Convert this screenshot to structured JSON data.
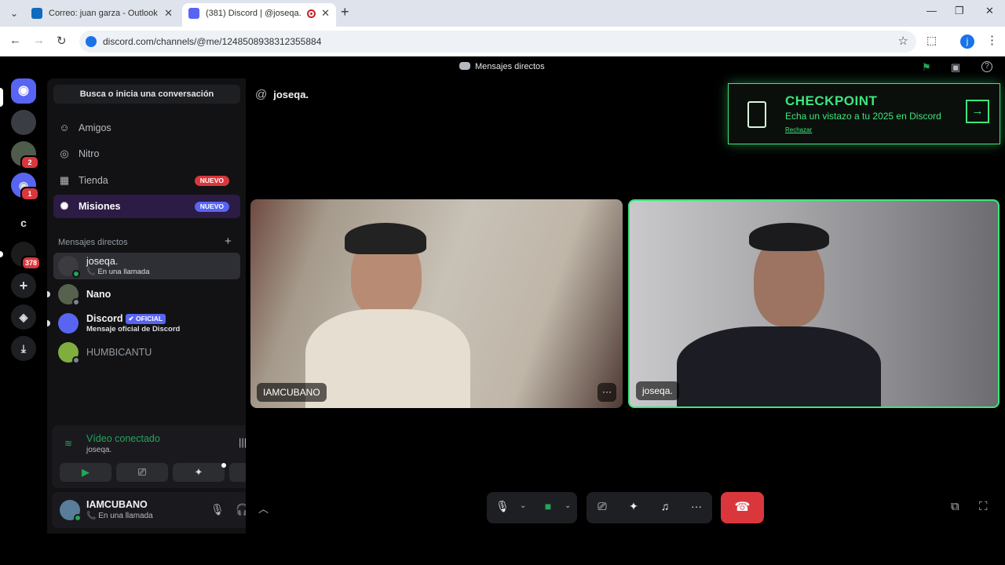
{
  "browser": {
    "tab_menu": "⌄",
    "tabs": [
      {
        "title": "Correo: juan garza - Outlook",
        "close": "✕"
      },
      {
        "title": "(381) Discord | @joseqa.",
        "close": "✕"
      }
    ],
    "new_tab": "+",
    "window_controls": {
      "minimize": "—",
      "maximize": "❐",
      "close": "✕"
    },
    "back": "←",
    "forward": "→",
    "reload": "↻",
    "url": "discord.com/channels/@me/1248508938312355884",
    "bookmark_star": "☆",
    "extensions": "⬚",
    "profile_initial": "j",
    "menu": "⋮"
  },
  "discord_top": {
    "title": "Mensajes directos",
    "icons": {
      "flag": "⚑",
      "inbox": "▣",
      "help": "?"
    }
  },
  "rail": {
    "home_glyph": "◉",
    "servers": [
      {
        "label": "",
        "badge": ""
      },
      {
        "label": "",
        "badge": "2"
      },
      {
        "label": "◉",
        "badge": "1"
      },
      {
        "label": "c",
        "badge": ""
      },
      {
        "label": "",
        "badge": "378"
      }
    ],
    "add": "+",
    "discover": "◈",
    "download": "⤓"
  },
  "sidebar": {
    "search_placeholder": "Busca o inicia una conversación",
    "nav": [
      {
        "label": "Amigos",
        "icon": "☺",
        "badge": ""
      },
      {
        "label": "Nitro",
        "icon": "◎",
        "badge": ""
      },
      {
        "label": "Tienda",
        "icon": "▦",
        "badge": "NUEVO"
      },
      {
        "label": "Misiones",
        "icon": "✺",
        "badge": "NUEVO"
      }
    ],
    "dm_header": "Mensajes directos",
    "dm_add": "+",
    "dms": [
      {
        "name": "joseqa.",
        "sub": "📞 En una llamada"
      },
      {
        "name": "Nano",
        "sub": ""
      },
      {
        "name": "Discord",
        "badge": "✔ OFICIAL",
        "sub": "Mensaje oficial de Discord"
      },
      {
        "name": "HUMBICANTU",
        "sub": ""
      }
    ]
  },
  "voice": {
    "title": "Vídeo conectado",
    "subtitle": "joseqa.",
    "signal_icon": "≋",
    "noise_icon": "|||",
    "disconnect_icon": "☎",
    "buttons": {
      "camera": "▶",
      "screen": "⎚",
      "activities": "✦",
      "soundboard": "♫"
    }
  },
  "user": {
    "name": "IAMCUBANO",
    "status": "📞 En una llamada",
    "mic": "🎙",
    "headset": "🎧",
    "settings": "⚙"
  },
  "main": {
    "channel_at": "@",
    "channel_name": "joseqa.",
    "promo": {
      "title": "CHECKPOINT",
      "subtitle": "Echa un vistazo a tu 2025 en Discord",
      "dismiss": "Rechazar",
      "arrow": "→"
    },
    "tiles": [
      {
        "name": "IAMCUBANO",
        "more": "···"
      },
      {
        "name": "joseqa."
      }
    ],
    "controls": {
      "expand": "︿",
      "mic": "🎙",
      "mic_chev": "⌄",
      "cam": "■",
      "cam_chev": "⌄",
      "screen": "⎚",
      "activities": "✦",
      "soundboard": "♫",
      "more": "···",
      "hangup": "☎",
      "popout": "⧉",
      "fullscreen": "⛶"
    }
  }
}
